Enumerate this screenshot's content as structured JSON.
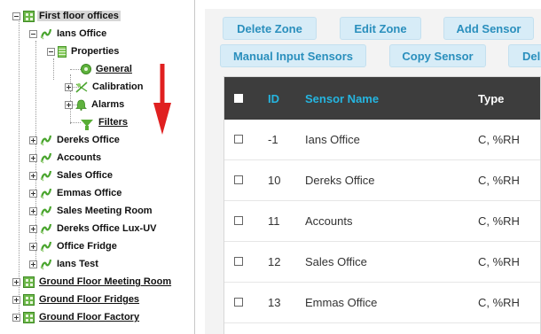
{
  "tree": {
    "root": {
      "label": "First floor offices"
    },
    "ians_office": {
      "label": "Ians Office"
    },
    "properties": {
      "label": "Properties"
    },
    "general": {
      "label": "General"
    },
    "calibration": {
      "label": "Calibration"
    },
    "alarms": {
      "label": "Alarms"
    },
    "filters": {
      "label": "Filters"
    },
    "sensors": [
      {
        "label": "Dereks Office"
      },
      {
        "label": "Accounts"
      },
      {
        "label": "Sales Office"
      },
      {
        "label": "Emmas Office"
      },
      {
        "label": "Sales Meeting Room"
      },
      {
        "label": "Dereks Office Lux-UV"
      },
      {
        "label": "Office Fridge"
      },
      {
        "label": "Ians Test"
      }
    ],
    "zones": [
      {
        "label": "Ground Floor Meeting Room"
      },
      {
        "label": "Ground Floor Fridges"
      },
      {
        "label": "Ground Floor Factory"
      }
    ]
  },
  "toolbar": {
    "delete_zone": "Delete Zone",
    "edit_zone": "Edit Zone",
    "add_sensor": "Add Sensor",
    "manual_input_sensors": "Manual Input Sensors",
    "copy_sensor": "Copy Sensor",
    "delete_partial": "Del"
  },
  "table": {
    "headers": {
      "id": "ID",
      "name": "Sensor Name",
      "type": "Type"
    },
    "rows": [
      {
        "id": "-1",
        "name": "Ians Office",
        "type": "C, %RH"
      },
      {
        "id": "10",
        "name": "Dereks Office",
        "type": "C, %RH"
      },
      {
        "id": "11",
        "name": "Accounts",
        "type": "C, %RH"
      },
      {
        "id": "12",
        "name": "Sales Office",
        "type": "C, %RH"
      },
      {
        "id": "13",
        "name": "Emmas Office",
        "type": "C, %RH"
      }
    ]
  },
  "colors": {
    "accent_cyan": "#25b5e0",
    "button_bg": "#d7ecf7",
    "button_text": "#2a8fbd",
    "table_header": "#3d3d3d",
    "annotation_arrow": "#e02020",
    "tree_green": "#6db84a"
  },
  "icons": {
    "zone": "grid-icon",
    "sensor": "sensor-wave-icon",
    "properties": "properties-icon",
    "general": "general-icon",
    "calibration": "calibration-icon",
    "alarms": "alarm-icon",
    "filters": "filter-icon",
    "annotation": "arrow-down-icon"
  }
}
